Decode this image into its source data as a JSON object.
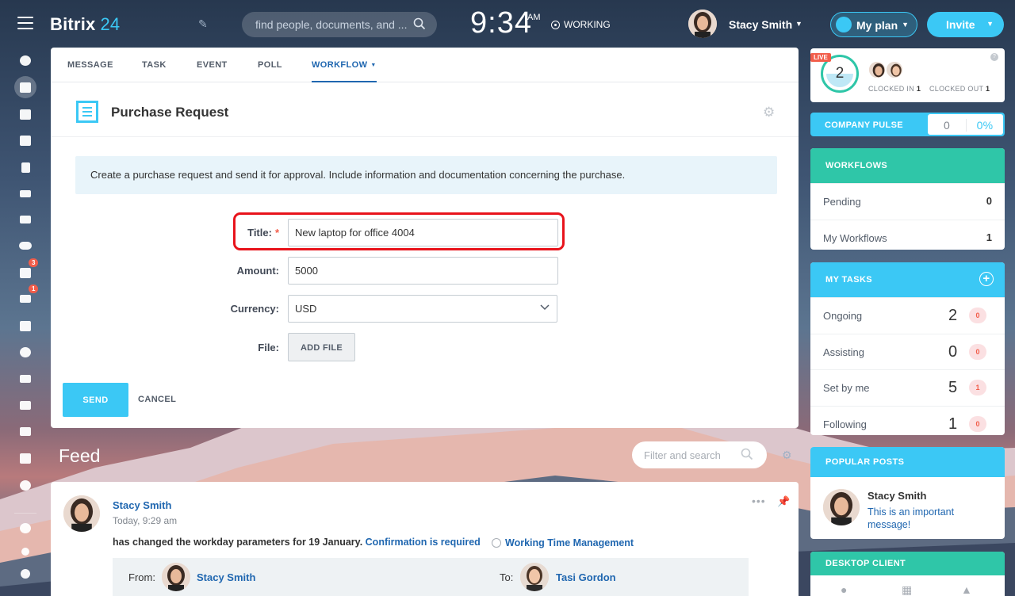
{
  "app": {
    "name": "Bitrix",
    "version": "24"
  },
  "search": {
    "placeholder": "find people, documents, and ..."
  },
  "clock": {
    "time": "9:34",
    "ampm": "AM",
    "status": "WORKING"
  },
  "user": {
    "name": "Stacy Smith"
  },
  "buttons": {
    "my_plan": "My plan",
    "invite": "Invite"
  },
  "leftnav": {
    "items": [
      "feed-icon",
      "news-icon",
      "chat-icon",
      "calendar-icon",
      "document-icon",
      "drive-icon",
      "mail-icon",
      "employees-icon",
      "tasks-icon",
      "crm-filter-icon",
      "company-icon",
      "target-icon",
      "shop-icon",
      "contact-center-icon",
      "robot-icon",
      "box-icon",
      "more-icon",
      "help-icon",
      "structure-icon",
      "settings-icon"
    ],
    "badges": {
      "tasks": "3",
      "crm": "1"
    }
  },
  "composer": {
    "tabs": [
      {
        "label": "MESSAGE"
      },
      {
        "label": "TASK"
      },
      {
        "label": "EVENT"
      },
      {
        "label": "POLL"
      },
      {
        "label": "WORKFLOW"
      }
    ],
    "active_tab": "WORKFLOW",
    "form_title": "Purchase Request",
    "description": "Create a purchase request and send it for approval. Include information and documentation concerning the purchase.",
    "fields": {
      "title_label": "Title:",
      "title_required": "*",
      "title_value": "New laptop for office 4004",
      "amount_label": "Amount:",
      "amount_value": "5000",
      "currency_label": "Currency:",
      "currency_value": "USD",
      "file_label": "File:",
      "add_file": "ADD FILE"
    },
    "send": "SEND",
    "cancel": "CANCEL"
  },
  "feed": {
    "title": "Feed",
    "filter_placeholder": "Filter and search",
    "post": {
      "author": "Stacy Smith",
      "time": "Today, 9:29 am",
      "text": "has changed the workday parameters for 19 January.",
      "confirm_link": "Confirmation is required",
      "tm_link": "Working Time Management",
      "from_label": "From:",
      "from_name": "Stacy Smith",
      "to_label": "To:",
      "to_name": "Tasi Gordon"
    }
  },
  "sidebar": {
    "live": "LIVE",
    "clocked": {
      "count": "2",
      "in_label": "CLOCKED IN",
      "in_value": "1",
      "out_label": "CLOCKED OUT",
      "out_value": "1"
    },
    "pulse": {
      "label": "COMPANY PULSE",
      "value": "0",
      "percent": "0%"
    },
    "workflows": {
      "title": "WORKFLOWS",
      "rows": [
        {
          "label": "Pending",
          "value": "0"
        },
        {
          "label": "My Workflows",
          "value": "1"
        }
      ]
    },
    "tasks": {
      "title": "MY TASKS",
      "rows": [
        {
          "label": "Ongoing",
          "value": "2",
          "badge": "0"
        },
        {
          "label": "Assisting",
          "value": "0",
          "badge": "0"
        },
        {
          "label": "Set by me",
          "value": "5",
          "badge": "1"
        },
        {
          "label": "Following",
          "value": "1",
          "badge": "0"
        }
      ]
    },
    "popular": {
      "title": "POPULAR POSTS",
      "author": "Stacy Smith",
      "message": "This is an important message!"
    },
    "desktop": {
      "title": "DESKTOP CLIENT"
    }
  },
  "colors": {
    "accent": "#3bc8f5",
    "link": "#2067b0",
    "workflows_header": "#2fc6a8",
    "alert": "#f25d4a",
    "highlight": "#e8131b"
  }
}
